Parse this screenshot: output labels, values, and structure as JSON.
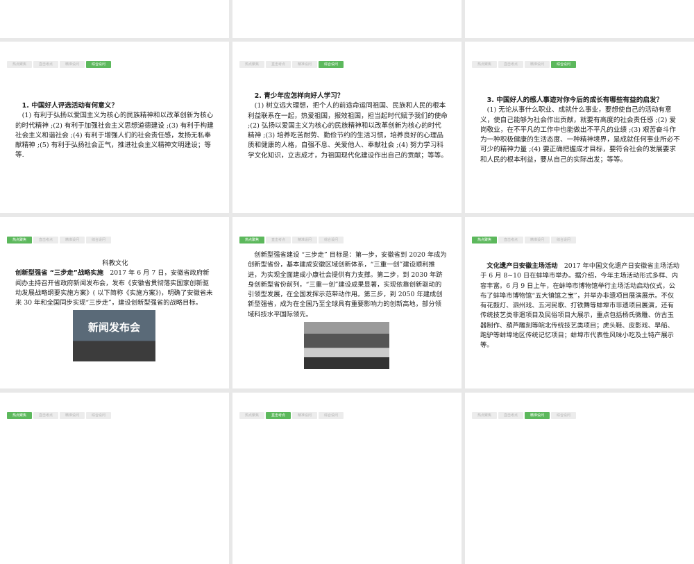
{
  "tabs": [
    "热点聚焦",
    "直击考点",
    "精准设问",
    "综合设问"
  ],
  "slides": [
    {
      "q": "1. 中国好人评选活动有何意义？",
      "a": "(1) 有利于弘扬以爱国主义为核心的民族精神和以改革创新为核心的时代精神 ;(2) 有利于加强社会主义思想道德建设 ;(3) 有利于构建社会主义和谐社会 ;(4) 有利于增强人们的社会责任感，发扬无私奉献精神 ;(5) 有利于弘扬社会正气，推进社会主义精神文明建设；等等."
    },
    {
      "q": "2. 青少年应怎样向好人学习？",
      "a": "(1) 树立远大理想，把个人的前途命运同祖国、民族和人民的根本利益联系在一起，热爱祖国，报效祖国，担当起时代赋予我们的使命 ;(2) 弘扬以爱国主义为核心的民族精神和以改革创新为核心的时代精神 ;(3) 培养吃苦耐劳、勤俭节约的生活习惯，培养良好的心理品质和健康的人格，自强不息、关爱他人、奉献社会 ;(4) 努力学习科学文化知识，立志成才，为祖国现代化建设作出自己的贡献；等等。"
    },
    {
      "q": "3. 中国好人的感人事迹对你今后的成长有哪些有益的启发？",
      "a": "(1) 无论从事什么职业、成就什么事业，要想使自己的活动有意义，使自己能够为社会作出贡献，就要有高度的社会责任感 ;(2) 爱岗敬业，在不平凡的工作中也能做出不平凡的业绩 ;(3) 艰苦奋斗作为一种积极健康的生活态度、一种精神境界，是成就任何事业所必不可少的精神力量 ;(4) 要正确把握成才目标，要符合社会的发展要求和人民的根本利益，要从自己的实际出发；等等。"
    },
    {
      "heading": "科教文化",
      "bold": "创新型强省 “三步走”战略实施",
      "text": "　2017 年 6 月 7 日，安徽省政府新闻办主持召开省政府新闻发布会，发布《安徽省贯彻落实国家创新驱动发展战略纲要实施方案》( 以下简称《实施方案》)，明确了安徽省未来 30 年和全国同步实现“三步走”，建设创新型强省的战略目标。",
      "photo_text": "新闻发布会"
    },
    {
      "text": "创新型强省建设 “三步走” 目标是：第一步，安徽省到 2020 年成为创新型省份，基本建成安徽区域创新体系，“三重一创”建设顺利推进，为实现全面建成小康社会提供有力支撑。第二步，到 2030 年跻身创新型省份前列，“三重一创”建设成果显著，实现依靠创新驱动的引领型发展，在全国发挥示范带动作用。第三步，到 2050 年建成创新型强省，成为在全国乃至全球具有重要影响力的创新高地，部分领域科技水平国际领先。"
    },
    {
      "bold": "文化遗产日安徽主场活动",
      "text": "　2017 年中国文化遗产日安徽省主场活动于 6 月 8~10 日在蚌埠市举办。据介绍，今年主场活动形式多样、内容丰富。6 月 9 日上午，在蚌埠市博物馆举行主场活动启动仪式，公布了蚌埠市博物馆“五大镇馆之宝”，并举办非遗项目展演展示。不仅有花鼓灯、泗州戏、五河民歌、打铁舞等蚌埠市非遗项目展演，还有传统技艺类非遗项目及民俗项目大展示，重点包括杨氏微雕、仿古玉器制作、葫芦雕刻等皖北传统技艺类项目；虎头鞋、皮影戏、旱船、跑驴等蚌埠地区传统记忆项目；蚌埠市代表性风味小吃及土特产展示等。"
    }
  ]
}
